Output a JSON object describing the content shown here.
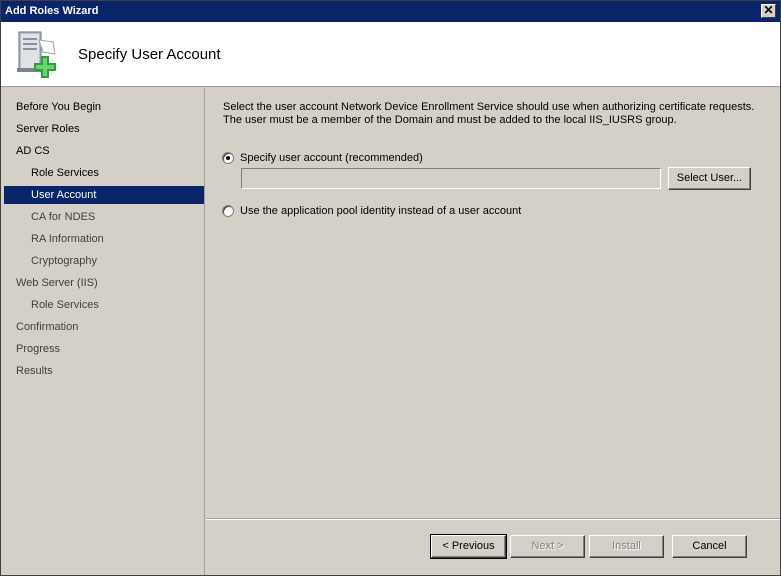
{
  "window": {
    "title": "Add Roles Wizard",
    "close_glyph": "✕"
  },
  "header": {
    "heading": "Specify User Account",
    "icon": "server-add-icon"
  },
  "nav": {
    "items": [
      {
        "label": "Before You Begin",
        "level": "top",
        "state": "done"
      },
      {
        "label": "Server Roles",
        "level": "top",
        "state": "done"
      },
      {
        "label": "AD CS",
        "level": "top",
        "state": "done"
      },
      {
        "label": "Role Services",
        "level": "sub",
        "state": "done"
      },
      {
        "label": "User Account",
        "level": "sub",
        "state": "selected"
      },
      {
        "label": "CA for NDES",
        "level": "sub",
        "state": "future"
      },
      {
        "label": "RA Information",
        "level": "sub",
        "state": "future"
      },
      {
        "label": "Cryptography",
        "level": "sub",
        "state": "future"
      },
      {
        "label": "Web Server (IIS)",
        "level": "top",
        "state": "future"
      },
      {
        "label": "Role Services",
        "level": "sub",
        "state": "future"
      },
      {
        "label": "Confirmation",
        "level": "top",
        "state": "future"
      },
      {
        "label": "Progress",
        "level": "top",
        "state": "future"
      },
      {
        "label": "Results",
        "level": "top",
        "state": "future"
      }
    ]
  },
  "content": {
    "instruction_line1": "Select the user account Network Device Enrollment Service should use when authorizing certificate requests.",
    "instruction_line2": "The user must be a member of the Domain and must be added to the local IIS_IUSRS group.",
    "option_specify": "Specify user account (recommended)",
    "user_field_value": "",
    "select_user_button": "Select User...",
    "option_app_pool": "Use the application pool identity instead of a user account"
  },
  "footer": {
    "previous": "< Previous",
    "next": "Next >",
    "install": "Install",
    "cancel": "Cancel"
  },
  "colors": {
    "selection": "#0a246a",
    "face": "#d4d0c8"
  }
}
